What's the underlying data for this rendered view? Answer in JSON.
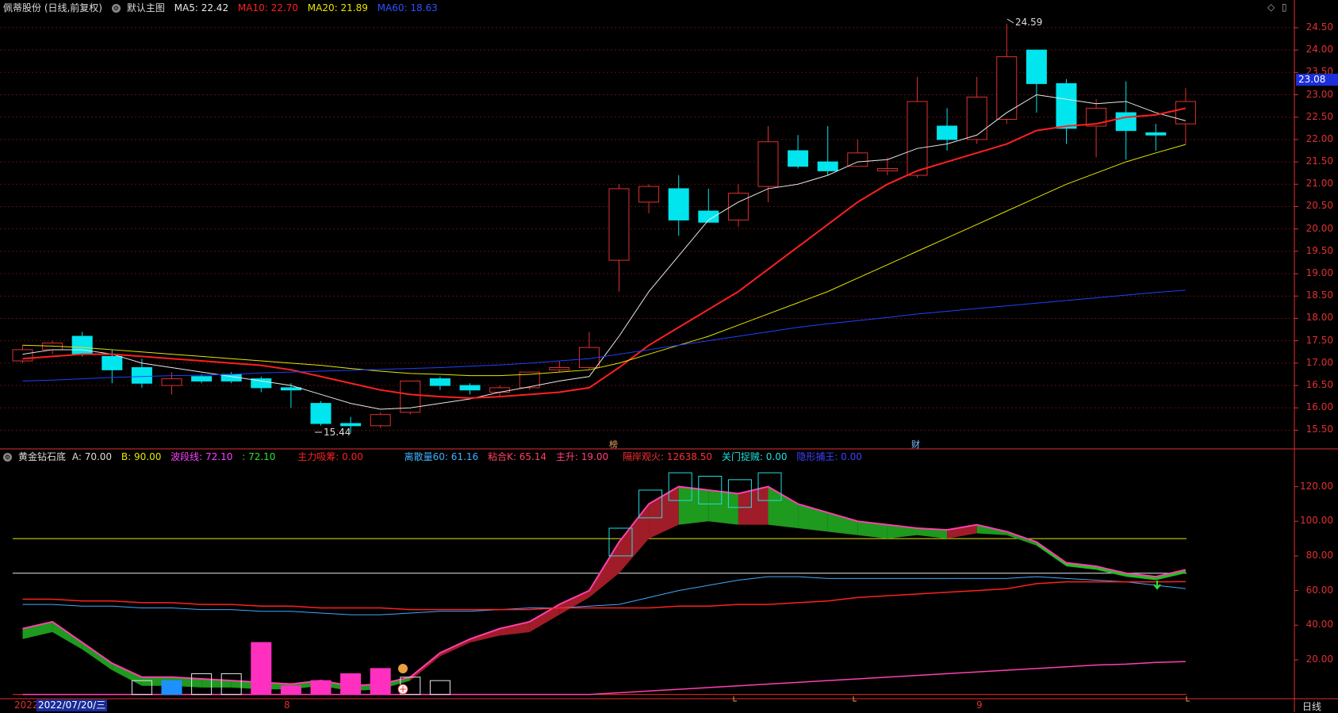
{
  "main_header": {
    "stock": "佩蒂股份 (日线,前复权)",
    "template": "默认主图",
    "ma5": "MA5: 22.42",
    "ma10": "MA10: 22.70",
    "ma20": "MA20: 21.89",
    "ma60": "MA60: 18.63"
  },
  "sub_header": {
    "indicator": "黄金钻石底",
    "a": "A: 70.00",
    "b": "B: 90.00",
    "wave": "波段线: 72.10",
    "wave2": ": 72.10",
    "main_force": "主力吸筹: 0.00",
    "discrete": "离散量60: 61.16",
    "bond_k": "粘合K: 65.14",
    "main_rise": "主升: 19.00",
    "watch": "隔岸观火: 12638.50",
    "gate": "关门捉贼: 0.00",
    "hidden": "隐形捕王: 0.00"
  },
  "colors": {
    "up": "#e03030",
    "down": "#00e5ee",
    "ma5": "#e8e8e8",
    "ma10": "#ff2020",
    "ma20": "#e6e600",
    "ma60": "#2040ff",
    "axis": "#e03030"
  },
  "icons": {
    "settings": "gear-icon",
    "diamond": "diamond-icon",
    "window": "window-icon"
  },
  "labels": {
    "current_price": "23.08",
    "high": "24.59",
    "low": "15.44",
    "mark_bang": "榜",
    "mark_cai": "财",
    "date": "2022/07/20/三",
    "year": "2022",
    "month8": "8",
    "month9": "9",
    "period": "日线"
  },
  "chart_data": [
    {
      "type": "candlestick",
      "name": "佩蒂股份 (日线,前复权)",
      "y_ticks": [
        "24.50",
        "24.00",
        "23.50",
        "23.00",
        "22.50",
        "22.00",
        "21.50",
        "21.00",
        "20.50",
        "20.00",
        "19.50",
        "19.00",
        "18.50",
        "18.00",
        "17.50",
        "17.00",
        "16.50",
        "16.00",
        "15.50"
      ],
      "ylim": [
        15.1,
        24.8
      ],
      "candles": [
        {
          "o": 17.05,
          "h": 17.4,
          "l": 17.0,
          "c": 17.3
        },
        {
          "o": 17.3,
          "h": 17.5,
          "l": 17.2,
          "c": 17.45
        },
        {
          "o": 17.6,
          "h": 17.7,
          "l": 17.15,
          "c": 17.2
        },
        {
          "o": 17.15,
          "h": 17.3,
          "l": 16.55,
          "c": 16.85
        },
        {
          "o": 16.9,
          "h": 17.1,
          "l": 16.45,
          "c": 16.55
        },
        {
          "o": 16.5,
          "h": 16.8,
          "l": 16.3,
          "c": 16.65
        },
        {
          "o": 16.7,
          "h": 16.75,
          "l": 16.55,
          "c": 16.6
        },
        {
          "o": 16.75,
          "h": 16.8,
          "l": 16.55,
          "c": 16.6
        },
        {
          "o": 16.65,
          "h": 16.7,
          "l": 16.35,
          "c": 16.45
        },
        {
          "o": 16.45,
          "h": 16.55,
          "l": 16.0,
          "c": 16.4
        },
        {
          "o": 16.1,
          "h": 16.15,
          "l": 15.6,
          "c": 15.65
        },
        {
          "o": 15.65,
          "h": 15.8,
          "l": 15.44,
          "c": 15.6
        },
        {
          "o": 15.6,
          "h": 15.9,
          "l": 15.55,
          "c": 15.85
        },
        {
          "o": 15.9,
          "h": 16.6,
          "l": 15.85,
          "c": 16.6
        },
        {
          "o": 16.65,
          "h": 16.7,
          "l": 16.4,
          "c": 16.5
        },
        {
          "o": 16.5,
          "h": 16.55,
          "l": 16.3,
          "c": 16.4
        },
        {
          "o": 16.35,
          "h": 16.5,
          "l": 16.25,
          "c": 16.45
        },
        {
          "o": 16.45,
          "h": 16.8,
          "l": 16.4,
          "c": 16.8
        },
        {
          "o": 16.85,
          "h": 17.05,
          "l": 16.8,
          "c": 16.9
        },
        {
          "o": 16.9,
          "h": 17.7,
          "l": 16.85,
          "c": 17.35
        },
        {
          "o": 19.3,
          "h": 21.0,
          "l": 18.6,
          "c": 20.9
        },
        {
          "o": 20.6,
          "h": 21.0,
          "l": 20.35,
          "c": 20.95
        },
        {
          "o": 20.9,
          "h": 21.2,
          "l": 19.85,
          "c": 20.2
        },
        {
          "o": 20.4,
          "h": 20.9,
          "l": 20.15,
          "c": 20.15
        },
        {
          "o": 20.2,
          "h": 21.0,
          "l": 20.05,
          "c": 20.8
        },
        {
          "o": 20.95,
          "h": 22.3,
          "l": 20.6,
          "c": 21.95
        },
        {
          "o": 21.75,
          "h": 22.1,
          "l": 21.35,
          "c": 21.4
        },
        {
          "o": 21.5,
          "h": 22.3,
          "l": 21.2,
          "c": 21.3
        },
        {
          "o": 21.4,
          "h": 22.0,
          "l": 21.4,
          "c": 21.7
        },
        {
          "o": 21.3,
          "h": 21.6,
          "l": 21.2,
          "c": 21.35
        },
        {
          "o": 21.2,
          "h": 23.4,
          "l": 21.15,
          "c": 22.85
        },
        {
          "o": 22.3,
          "h": 22.7,
          "l": 21.75,
          "c": 22.0
        },
        {
          "o": 22.0,
          "h": 23.4,
          "l": 21.9,
          "c": 22.95
        },
        {
          "o": 22.45,
          "h": 24.59,
          "l": 22.35,
          "c": 23.85
        },
        {
          "o": 24.0,
          "h": 24.0,
          "l": 22.6,
          "c": 23.25
        },
        {
          "o": 23.25,
          "h": 23.35,
          "l": 21.9,
          "c": 22.25
        },
        {
          "o": 22.3,
          "h": 22.9,
          "l": 21.6,
          "c": 22.7
        },
        {
          "o": 22.6,
          "h": 23.3,
          "l": 21.55,
          "c": 22.2
        },
        {
          "o": 22.15,
          "h": 22.35,
          "l": 21.75,
          "c": 22.1
        },
        {
          "o": 22.35,
          "h": 23.15,
          "l": 21.9,
          "c": 22.85
        }
      ],
      "series": [
        {
          "name": "MA5",
          "values": [
            17.2,
            17.3,
            17.3,
            17.2,
            17.0,
            16.9,
            16.8,
            16.7,
            16.6,
            16.5,
            16.3,
            16.1,
            15.97,
            16.0,
            16.1,
            16.2,
            16.35,
            16.47,
            16.6,
            16.7,
            17.6,
            18.6,
            19.4,
            20.2,
            20.6,
            20.9,
            21.0,
            21.2,
            21.5,
            21.55,
            21.8,
            21.9,
            22.1,
            22.6,
            23.0,
            22.9,
            22.8,
            22.85,
            22.6,
            22.42
          ]
        },
        {
          "name": "MA10",
          "values": [
            17.1,
            17.15,
            17.2,
            17.2,
            17.15,
            17.1,
            17.05,
            17.0,
            16.95,
            16.85,
            16.7,
            16.55,
            16.4,
            16.3,
            16.25,
            16.22,
            16.25,
            16.3,
            16.35,
            16.45,
            16.9,
            17.4,
            17.8,
            18.2,
            18.6,
            19.1,
            19.6,
            20.1,
            20.6,
            21.0,
            21.3,
            21.5,
            21.7,
            21.9,
            22.2,
            22.3,
            22.35,
            22.5,
            22.55,
            22.7
          ]
        },
        {
          "name": "MA20",
          "values": [
            17.4,
            17.38,
            17.35,
            17.3,
            17.25,
            17.2,
            17.15,
            17.1,
            17.05,
            17.0,
            16.95,
            16.88,
            16.82,
            16.77,
            16.75,
            16.72,
            16.72,
            16.75,
            16.8,
            16.85,
            17.0,
            17.2,
            17.4,
            17.6,
            17.85,
            18.1,
            18.35,
            18.6,
            18.9,
            19.2,
            19.5,
            19.8,
            20.1,
            20.4,
            20.7,
            21.0,
            21.25,
            21.5,
            21.7,
            21.89
          ]
        },
        {
          "name": "MA60",
          "values": [
            16.6,
            16.62,
            16.65,
            16.68,
            16.7,
            16.72,
            16.73,
            16.75,
            16.78,
            16.8,
            16.82,
            16.84,
            16.86,
            16.88,
            16.9,
            16.93,
            16.96,
            17.0,
            17.05,
            17.1,
            17.2,
            17.3,
            17.4,
            17.5,
            17.6,
            17.7,
            17.8,
            17.88,
            17.95,
            18.02,
            18.1,
            18.16,
            18.22,
            18.28,
            18.34,
            18.4,
            18.46,
            18.52,
            18.58,
            18.63
          ]
        }
      ]
    },
    {
      "type": "indicator",
      "name": "黄金钻石底",
      "y_ticks": [
        "120.00",
        "100.00",
        "80.00",
        "60.00",
        "40.00",
        "20.00"
      ],
      "ylim": [
        -2,
        134
      ],
      "A": 70,
      "B": 90,
      "wave": [
        38,
        42,
        30,
        18,
        10,
        10,
        9,
        8,
        7,
        6,
        8,
        5,
        6,
        10,
        24,
        32,
        38,
        42,
        52,
        60,
        88,
        110,
        120,
        118,
        116,
        120,
        110,
        105,
        100,
        98,
        96,
        95,
        98,
        94,
        88,
        76,
        74,
        70,
        68,
        72
      ],
      "wave_lag": [
        32,
        36,
        26,
        14,
        5,
        5,
        4,
        4,
        3,
        3,
        5,
        2,
        3,
        8,
        22,
        30,
        34,
        36,
        46,
        56,
        70,
        90,
        98,
        100,
        98,
        98,
        96,
        94,
        92,
        90,
        92,
        90,
        93,
        92,
        86,
        74,
        72,
        68,
        66,
        70
      ],
      "discrete": [
        52,
        52,
        51,
        51,
        50,
        50,
        49,
        49,
        48,
        48,
        47,
        46,
        46,
        47,
        48,
        48,
        49,
        50,
        50,
        51,
        52,
        56,
        60,
        63,
        66,
        68,
        68,
        67,
        67,
        67,
        67,
        67,
        67,
        67,
        68,
        67,
        66,
        65,
        63,
        61.16
      ],
      "bond": [
        55,
        55,
        54,
        54,
        53,
        53,
        52,
        52,
        51,
        51,
        50,
        50,
        50,
        49,
        49,
        49,
        49,
        49,
        50,
        50,
        50,
        50,
        51,
        51,
        52,
        52,
        53,
        54,
        56,
        57,
        58,
        59,
        60,
        61,
        64,
        65,
        65,
        65,
        65,
        65.14
      ],
      "main_rise": [
        0,
        0,
        0,
        0,
        0,
        0,
        0,
        0,
        0,
        0,
        0,
        0,
        0,
        0,
        0,
        0,
        0,
        0,
        0,
        0,
        1,
        2,
        3,
        4,
        5,
        6,
        7,
        8,
        9,
        10,
        11,
        12,
        13,
        14,
        15,
        16,
        17,
        17.5,
        18.5,
        19
      ],
      "zone_blocks": [
        8,
        8,
        12,
        12,
        30,
        5,
        8,
        12,
        15,
        10,
        8
      ]
    }
  ]
}
